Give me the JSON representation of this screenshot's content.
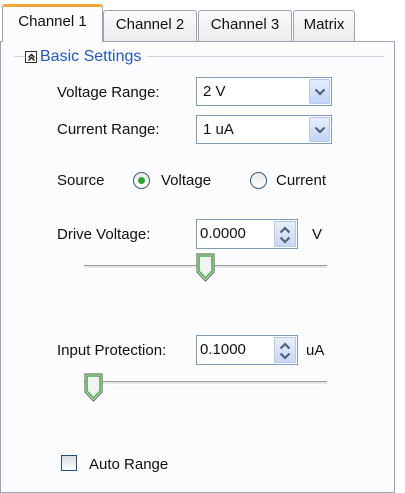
{
  "tabs": [
    {
      "label": "Channel 1"
    },
    {
      "label": "Channel 2"
    },
    {
      "label": "Channel 3"
    },
    {
      "label": "Matrix"
    }
  ],
  "group": {
    "title": "Basic Settings"
  },
  "voltage_range": {
    "label": "Voltage Range:",
    "value": "2 V"
  },
  "current_range": {
    "label": "Current Range:",
    "value": "1 uA"
  },
  "source": {
    "label": "Source",
    "options": [
      "Voltage",
      "Current"
    ],
    "selected": "Voltage"
  },
  "drive_voltage": {
    "label": "Drive Voltage:",
    "value": "0.0000",
    "unit": "V",
    "slider_position": 0.5
  },
  "input_protection": {
    "label": "Input Protection:",
    "value": "0.1000",
    "unit": "uA",
    "slider_position": 0.0
  },
  "auto_range": {
    "label": "Auto Range",
    "checked": false
  },
  "colors": {
    "active_tab_accent": "#f1a83a",
    "group_title": "#1f57c7",
    "radio_dot": "#2ea62e",
    "thumb_accent": "#4db04d"
  }
}
